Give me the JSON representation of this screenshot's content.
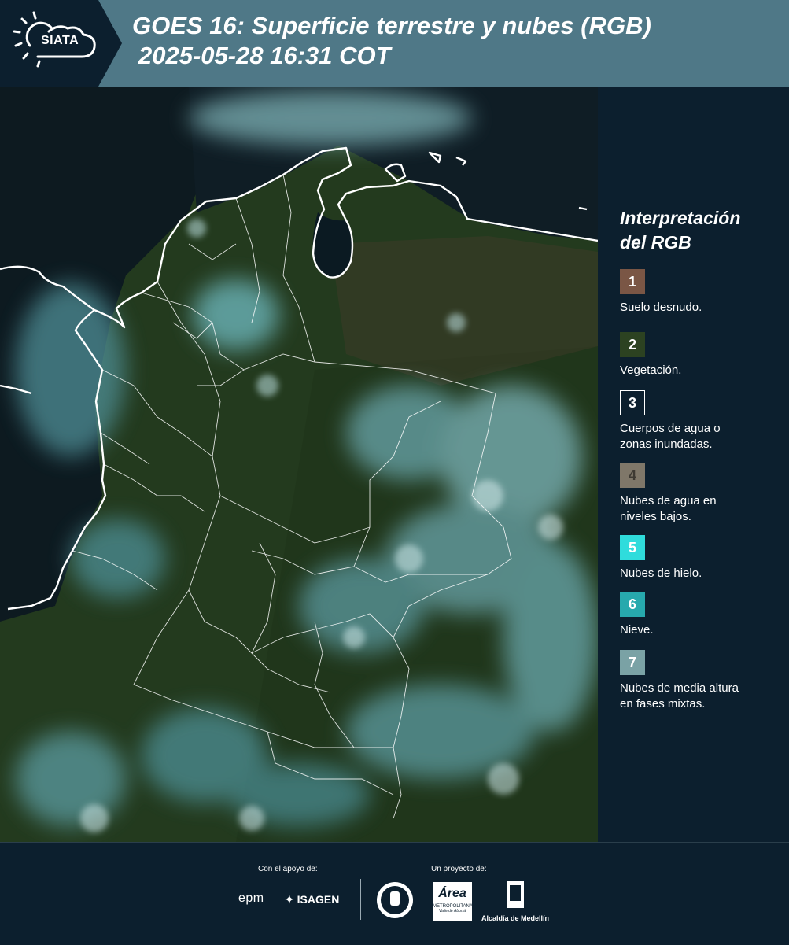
{
  "header": {
    "logo_text": "SIATA",
    "title_line1": "GOES 16: Superficie terrestre y nubes (RGB)",
    "title_line2": "2025-05-28 16:31 COT"
  },
  "legend": {
    "title_line1": "Interpretación",
    "title_line2": "del RGB",
    "items": [
      {
        "number": "1",
        "label": "Suelo desnudo.",
        "color": "#7a5645",
        "text_color": "#ffffff",
        "border": "none"
      },
      {
        "number": "2",
        "label": "Vegetación.",
        "color": "#2c4221",
        "text_color": "#ffffff",
        "border": "none"
      },
      {
        "number": "3",
        "label": "Cuerpos de agua o\nzonas inundadas.",
        "color": "#0c1f2e",
        "text_color": "#ffffff",
        "border": "1px solid #ffffff"
      },
      {
        "number": "4",
        "label": "Nubes de agua en\nniveles bajos.",
        "color": "#7f7769",
        "text_color": "#3e3a33",
        "border": "none"
      },
      {
        "number": "5",
        "label": "Nubes de hielo.",
        "color": "#2fdcdc",
        "text_color": "#ffffff",
        "border": "none"
      },
      {
        "number": "6",
        "label": "Nieve.",
        "color": "#27a9ad",
        "text_color": "#ffffff",
        "border": "none"
      },
      {
        "number": "7",
        "label": "Nubes de media altura\nen fases mixtas.",
        "color": "#7aa2a5",
        "text_color": "#ffffff",
        "border": "none"
      }
    ]
  },
  "footer": {
    "support_label": "Con el apoyo de:",
    "project_label": "Un proyecto de:",
    "sponsors": [
      "epm",
      "ISAGEN"
    ],
    "project_logos": {
      "area_text": "Área",
      "area_sub1": "METROPOLITANA",
      "area_sub2": "Valle de Aburrá",
      "medellin": "Alcaldía de Medellín"
    }
  }
}
